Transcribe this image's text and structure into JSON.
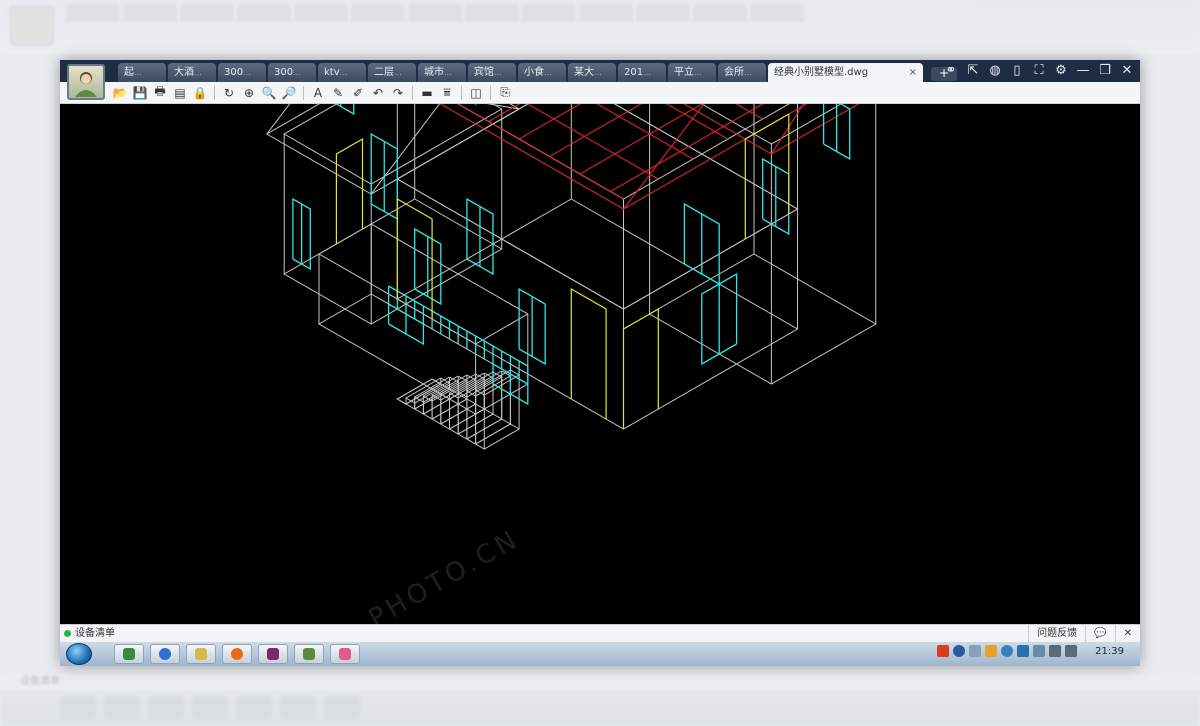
{
  "window": {
    "tabs": [
      {
        "label": "起",
        "dots": "..."
      },
      {
        "label": "大酒",
        "dots": "..."
      },
      {
        "label": "300",
        "dots": "..."
      },
      {
        "label": "300",
        "dots": "..."
      },
      {
        "label": "ktv",
        "dots": "..."
      },
      {
        "label": "二层",
        "dots": "..."
      },
      {
        "label": "城市",
        "dots": "..."
      },
      {
        "label": "宾馆",
        "dots": "..."
      },
      {
        "label": "小食",
        "dots": "..."
      },
      {
        "label": "某大",
        "dots": "..."
      },
      {
        "label": "201",
        "dots": "..."
      },
      {
        "label": "平立",
        "dots": "..."
      },
      {
        "label": "会所",
        "dots": "..."
      }
    ],
    "active_tab": {
      "label": "经典小别墅模型.dwg",
      "close": "×"
    },
    "new_tab": "+",
    "controls": {
      "users": "⚭",
      "share": "⇱",
      "chat": "◍",
      "phone": "▯",
      "fullscreen": "⛶",
      "settings": "⚙",
      "minimize": "—",
      "restore": "❐",
      "close": "✕"
    }
  },
  "toolbar": {
    "items": [
      {
        "name": "open-icon",
        "glyph": "📂"
      },
      {
        "name": "save-icon",
        "glyph": "💾"
      },
      {
        "name": "print-icon",
        "glyph": "🖶"
      },
      {
        "name": "pdf-icon",
        "glyph": "▤"
      },
      {
        "name": "lock-icon",
        "glyph": "🔒"
      },
      {
        "sep": true
      },
      {
        "name": "regen-icon",
        "glyph": "↻"
      },
      {
        "name": "zoom-window-icon",
        "glyph": "⊕"
      },
      {
        "name": "zoom-in-icon",
        "glyph": "🔍"
      },
      {
        "name": "zoom-out-icon",
        "glyph": "🔎"
      },
      {
        "sep": true
      },
      {
        "name": "text-icon",
        "glyph": "A"
      },
      {
        "name": "pencil-icon",
        "glyph": "✎"
      },
      {
        "name": "highlight-icon",
        "glyph": "✐"
      },
      {
        "name": "undo-icon",
        "glyph": "↶"
      },
      {
        "name": "redo-icon",
        "glyph": "↷"
      },
      {
        "sep": true
      },
      {
        "name": "measure-icon",
        "glyph": "▬"
      },
      {
        "name": "dimension-icon",
        "glyph": "⩸"
      },
      {
        "sep": true
      },
      {
        "name": "layers-icon",
        "glyph": "◫"
      },
      {
        "sep": true
      },
      {
        "name": "export-icon",
        "glyph": "⎘"
      }
    ]
  },
  "status": {
    "device_list": "设备清单",
    "feedback": "问题反馈",
    "chat_icon": "💬",
    "close": "✕"
  },
  "taskbar": {
    "clock": "21:39"
  },
  "colors": {
    "titlebar": "#1f2d44",
    "canvas": "#000000",
    "cyan": "#2ee6e6",
    "yellow": "#e6e62e",
    "red": "#e02a2a",
    "white": "#e8e8e8"
  }
}
